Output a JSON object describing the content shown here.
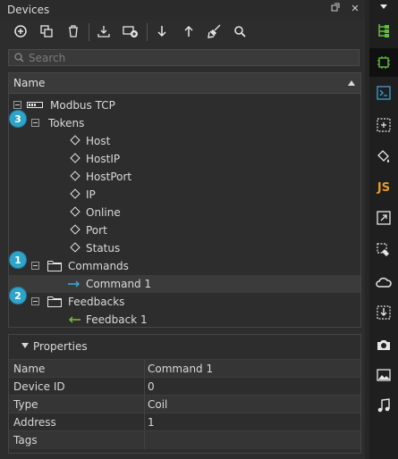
{
  "window": {
    "title": "Devices"
  },
  "search": {
    "placeholder": "Search"
  },
  "tree": {
    "column_header": "Name",
    "items": [
      {
        "label": "Modbus TCP"
      },
      {
        "label": "Tokens",
        "badge": "3"
      },
      {
        "label": "Host"
      },
      {
        "label": "HostIP"
      },
      {
        "label": "HostPort"
      },
      {
        "label": "IP"
      },
      {
        "label": "Online"
      },
      {
        "label": "Port"
      },
      {
        "label": "Status"
      },
      {
        "label": "Commands",
        "badge": "1"
      },
      {
        "label": "Command 1"
      },
      {
        "label": "Feedbacks",
        "badge": "2"
      },
      {
        "label": "Feedback 1"
      }
    ]
  },
  "properties": {
    "title": "Properties",
    "rows": [
      {
        "key": "Name",
        "value": "Command 1"
      },
      {
        "key": "Device ID",
        "value": "0"
      },
      {
        "key": "Type",
        "value": "Coil"
      },
      {
        "key": "Address",
        "value": "1"
      },
      {
        "key": "Tags",
        "value": ""
      }
    ]
  },
  "sidebar": {
    "js_label": "JS",
    "colors": {
      "green": "#5fbf3a",
      "blue": "#3a9fd9",
      "orange": "#e8972e"
    }
  },
  "colors": {
    "command_arrow": "#3aaee0",
    "feedback_arrow": "#7cc23c",
    "badge": "#2fa3c8"
  }
}
